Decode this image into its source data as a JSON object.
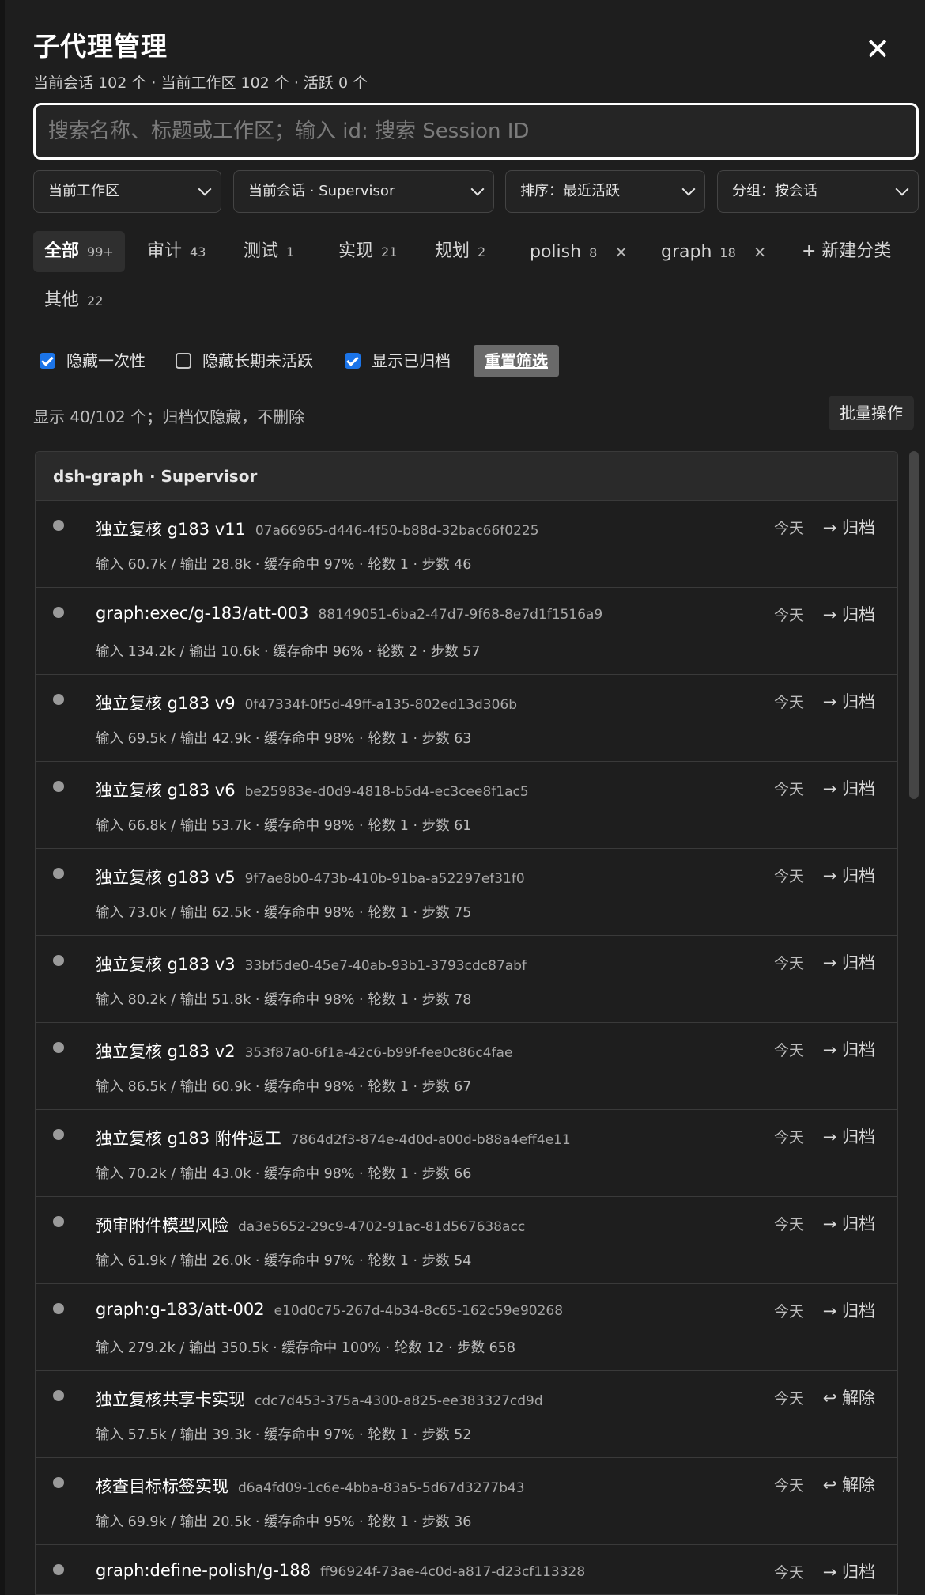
{
  "header": {
    "title": "子代理管理",
    "subtitle": "当前会话 102 个 · 当前工作区 102 个 · 活跃 0 个",
    "close_symbol": "✕"
  },
  "search": {
    "placeholder": "搜索名称、标题或工作区；输入 id: 搜索 Session ID",
    "value": ""
  },
  "selects": {
    "workspace": "当前工作区",
    "session": "当前会话 · Supervisor",
    "sort": "排序：最近活跃",
    "group": "分组：按会话"
  },
  "tabs": [
    {
      "label": "全部",
      "count": "99+",
      "active": true
    },
    {
      "label": "审计",
      "count": "43"
    },
    {
      "label": "测试",
      "count": "1"
    },
    {
      "label": "实现",
      "count": "21"
    },
    {
      "label": "规划",
      "count": "2"
    },
    {
      "label": "polish",
      "count": "8",
      "closable": "×"
    },
    {
      "label": "graph",
      "count": "18",
      "closable": "×"
    },
    {
      "label": "+ 新建分类"
    },
    {
      "label": "其他",
      "count": "22"
    }
  ],
  "filters": {
    "hide_oneoff": {
      "label": "隐藏一次性",
      "checked": true
    },
    "hide_inactive": {
      "label": "隐藏长期未活跃",
      "checked": false
    },
    "show_archived": {
      "label": "显示已归档",
      "checked": true
    },
    "reset_label": "重置筛选"
  },
  "summary": {
    "text": "显示 40/102 个；归档仅隐藏，不删除",
    "batch_label": "批量操作"
  },
  "group": {
    "title": "dsh-graph · Supervisor",
    "toggle_symbol": "^"
  },
  "rows": [
    {
      "title": "独立复核 g183 v11",
      "id": "07a66965-d446-4f50-b88d-32bac66f0225",
      "meta": "输入 60.7k / 输出 28.8k · 缓存命中 97% · 轮数 1 · 步数 46",
      "date": "今天",
      "action": "→ 归档"
    },
    {
      "title": "graph:exec/g-183/att-003",
      "id": "88149051-6ba2-47d7-9f68-8e7d1f1516a9",
      "meta": "输入 134.2k / 输出 10.6k · 缓存命中 96% · 轮数 2 · 步数 57",
      "date": "今天",
      "action": "→ 归档"
    },
    {
      "title": "独立复核 g183 v9",
      "id": "0f47334f-0f5d-49ff-a135-802ed13d306b",
      "meta": "输入 69.5k / 输出 42.9k · 缓存命中 98% · 轮数 1 · 步数 63",
      "date": "今天",
      "action": "→ 归档"
    },
    {
      "title": "独立复核 g183 v6",
      "id": "be25983e-d0d9-4818-b5d4-ec3cee8f1ac5",
      "meta": "输入 66.8k / 输出 53.7k · 缓存命中 98% · 轮数 1 · 步数 61",
      "date": "今天",
      "action": "→ 归档"
    },
    {
      "title": "独立复核 g183 v5",
      "id": "9f7ae8b0-473b-410b-91ba-a52297ef31f0",
      "meta": "输入 73.0k / 输出 62.5k · 缓存命中 98% · 轮数 1 · 步数 75",
      "date": "今天",
      "action": "→ 归档"
    },
    {
      "title": "独立复核 g183 v3",
      "id": "33bf5de0-45e7-40ab-93b1-3793cdc87abf",
      "meta": "输入 80.2k / 输出 51.8k · 缓存命中 98% · 轮数 1 · 步数 78",
      "date": "今天",
      "action": "→ 归档"
    },
    {
      "title": "独立复核 g183 v2",
      "id": "353f87a0-6f1a-42c6-b99f-fee0c86c4fae",
      "meta": "输入 86.5k / 输出 60.9k · 缓存命中 98% · 轮数 1 · 步数 67",
      "date": "今天",
      "action": "→ 归档"
    },
    {
      "title": "独立复核 g183 附件返工",
      "id": "7864d2f3-874e-4d0d-a00d-b88a4eff4e11",
      "meta": "输入 70.2k / 输出 43.0k · 缓存命中 98% · 轮数 1 · 步数 66",
      "date": "今天",
      "action": "→ 归档"
    },
    {
      "title": "预审附件模型风险",
      "id": "da3e5652-29c9-4702-91ac-81d567638acc",
      "meta": "输入 61.9k / 输出 26.0k · 缓存命中 97% · 轮数 1 · 步数 54",
      "date": "今天",
      "action": "→ 归档"
    },
    {
      "title": "graph:g-183/att-002",
      "id": "e10d0c75-267d-4b34-8c65-162c59e90268",
      "meta": "输入 279.2k / 输出 350.5k · 缓存命中 100% · 轮数 12 · 步数 658",
      "date": "今天",
      "action": "→ 归档"
    },
    {
      "title": "独立复核共享卡实现",
      "id": "cdc7d453-375a-4300-a825-ee383327cd9d",
      "meta": "输入 57.5k / 输出 39.3k · 缓存命中 97% · 轮数 1 · 步数 52",
      "date": "今天",
      "action": "↩ 解除"
    },
    {
      "title": "核查目标标签实现",
      "id": "d6a4fd09-1c6e-4bba-83a5-5d67d3277b43",
      "meta": "输入 69.9k / 输出 20.5k · 缓存命中 95% · 轮数 1 · 步数 36",
      "date": "今天",
      "action": "↩ 解除"
    },
    {
      "title": "graph:define-polish/g-188",
      "id": "ff96924f-73ae-4c0d-a817-d23cf113328",
      "meta": "",
      "date": "今天",
      "action": "→ 归档"
    }
  ]
}
